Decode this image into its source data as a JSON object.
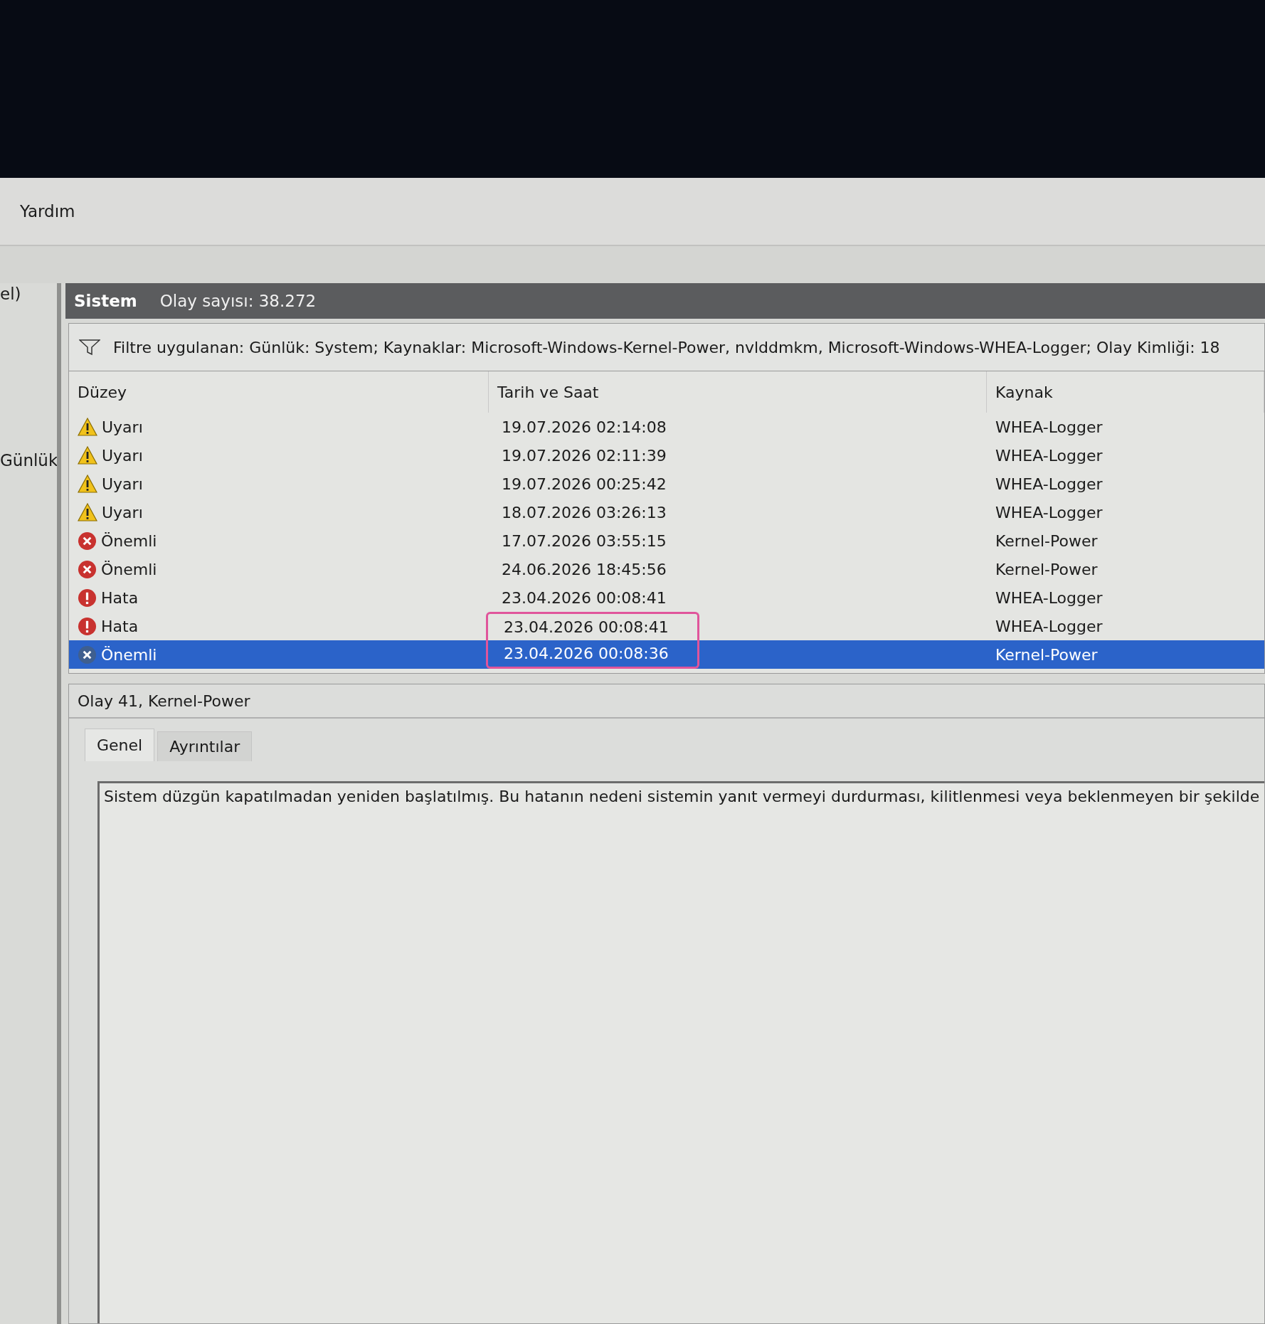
{
  "menu": {
    "items": [
      "Yardım"
    ]
  },
  "left_pane": {
    "items": [
      "el)",
      "Günlük"
    ]
  },
  "panel": {
    "title": "Sistem",
    "count": "Olay sayısı: 38.272"
  },
  "filter": {
    "text": "Filtre uygulanan: Günlük: System; Kaynaklar: Microsoft-Windows-Kernel-Power, nvlddmkm, Microsoft-Windows-WHEA-Logger; Olay Kimliği: 18"
  },
  "table": {
    "columns": [
      "Düzey",
      "Tarih ve Saat",
      "Kaynak"
    ],
    "rows": [
      {
        "kind": "warning",
        "level": "Uyarı",
        "date": "19.07.2026 02:14:08",
        "source": "WHEA-Logger",
        "selected": false,
        "circled": false
      },
      {
        "kind": "warning",
        "level": "Uyarı",
        "date": "19.07.2026 02:11:39",
        "source": "WHEA-Logger",
        "selected": false,
        "circled": false
      },
      {
        "kind": "warning",
        "level": "Uyarı",
        "date": "19.07.2026 00:25:42",
        "source": "WHEA-Logger",
        "selected": false,
        "circled": false
      },
      {
        "kind": "warning",
        "level": "Uyarı",
        "date": "18.07.2026 03:26:13",
        "source": "WHEA-Logger",
        "selected": false,
        "circled": false
      },
      {
        "kind": "critical",
        "level": "Önemli",
        "date": "17.07.2026 03:55:15",
        "source": "Kernel-Power",
        "selected": false,
        "circled": false
      },
      {
        "kind": "critical",
        "level": "Önemli",
        "date": "24.06.2026 18:45:56",
        "source": "Kernel-Power",
        "selected": false,
        "circled": false
      },
      {
        "kind": "error",
        "level": "Hata",
        "date": "23.04.2026 00:08:41",
        "source": "WHEA-Logger",
        "selected": false,
        "circled": false
      },
      {
        "kind": "error",
        "level": "Hata",
        "date": "23.04.2026 00:08:41",
        "source": "WHEA-Logger",
        "selected": false,
        "circled": true
      },
      {
        "kind": "critical",
        "level": "Önemli",
        "date": "23.04.2026 00:08:36",
        "source": "Kernel-Power",
        "selected": true,
        "circled": true
      }
    ]
  },
  "detail": {
    "title": "Olay 41, Kernel-Power",
    "tabs": [
      {
        "label": "Genel",
        "selected": true
      },
      {
        "label": "Ayrıntılar",
        "selected": false
      }
    ],
    "description": "Sistem düzgün kapatılmadan yeniden başlatılmış. Bu hatanın nedeni sistemin yanıt vermeyi durdurması, kilitlenmesi veya beklenmeyen bir şekilde"
  }
}
